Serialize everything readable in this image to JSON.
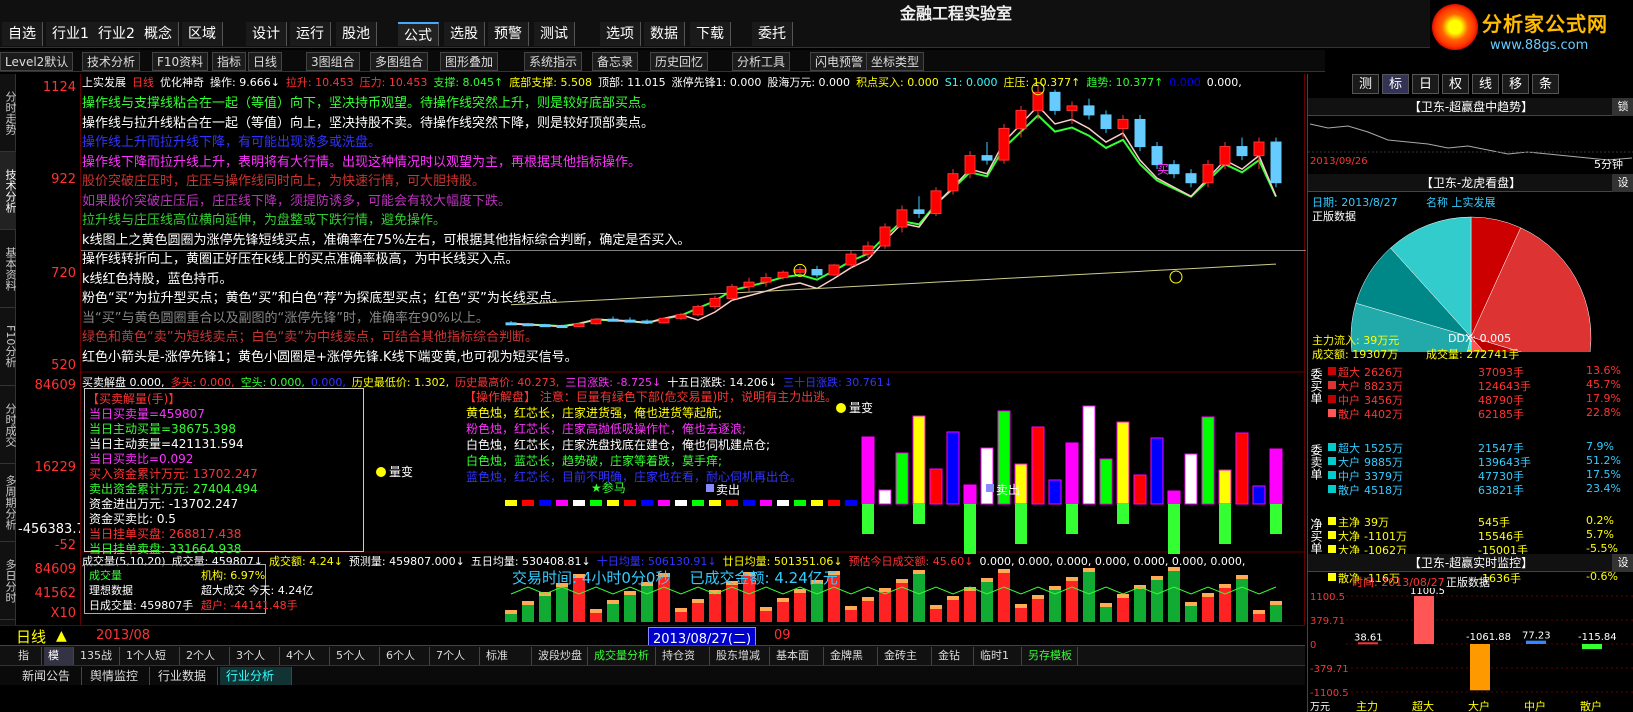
{
  "app_title": "金融工程实验室",
  "top_menu": [
    "自选",
    "行业1",
    "行业2",
    "概念",
    "区域",
    "设计",
    "运行",
    "股池",
    "公式",
    "选股",
    "预警",
    "测试",
    "选项",
    "数据",
    "下载",
    "委托"
  ],
  "toolbar": [
    "Level2默认",
    "技术分析",
    "F10资料",
    "指标",
    "日线",
    "3图组合",
    "多图组合",
    "图形叠加",
    "系统指示",
    "备忘录",
    "历史回忆",
    "分析工具",
    "闪电预警",
    "坐标类型"
  ],
  "logo": {
    "name": "分析家公式网",
    "url": "www.88gs.com"
  },
  "left_tabs": [
    "分时走势",
    "技术分析",
    "基本资料",
    "F10分析",
    "分时成交",
    "多周期分析",
    "多日分时"
  ],
  "price_scale": [
    "1124",
    "922",
    "720",
    "520"
  ],
  "vol_scale": [
    "84609",
    "16229",
    "-456383.7",
    "-52"
  ],
  "vol2_scale": [
    "84609",
    "41562",
    "X10"
  ],
  "header": {
    "name": "上实发展",
    "period": "日线",
    "indicator": "优化神奇",
    "items": [
      {
        "t": "操作: 9.666↓",
        "c": "#fff"
      },
      {
        "t": "拉升: 10.453",
        "c": "#f33"
      },
      {
        "t": "压力: 10.453",
        "c": "#f33"
      },
      {
        "t": "支撑: 8.045↑",
        "c": "#3f3"
      },
      {
        "t": "底部支撑: 5.508",
        "c": "#ff0"
      },
      {
        "t": "顶部: 11.015",
        "c": "#fff"
      },
      {
        "t": "涨停先锋1: 0.000",
        "c": "#fff"
      },
      {
        "t": "股海万元: 0.000",
        "c": "#fff"
      },
      {
        "t": "积点买入: 0.000",
        "c": "#ff0"
      },
      {
        "t": "S1: 0.000",
        "c": "#3ff"
      },
      {
        "t": "庄压: 10.377↑",
        "c": "#ff0"
      },
      {
        "t": "趋势: 10.377↑",
        "c": "#3f3"
      },
      {
        "t": "0.000",
        "c": "#00f"
      },
      {
        "t": "0.000,",
        "c": "#fff"
      }
    ]
  },
  "annotations": [
    {
      "t": "操作线与支撑线粘合在一起（等值）向下，坚决持币观望。待操作线突然上升，则是较好底部买点。",
      "c": "#3f3"
    },
    {
      "t": "操作线与拉升线粘合在一起（等值）向上，坚决持股不卖。待操作线突然下降，则是较好顶部卖点。",
      "c": "#fff"
    },
    {
      "t": "操作线上升而拉升线下降，有可能出现诱多或洗盘。",
      "c": "#33f"
    },
    {
      "t": "操作线下降而拉升线上升，表明将有大行情。出现这种情况时以观望为主，再根据其他指标操作。",
      "c": "#f3f"
    },
    {
      "t": "股价突破庄压时，庄压与操作线同时向上，为快速行情，可大胆持股。",
      "c": "#c33"
    },
    {
      "t": "如果股价突破庄压后，庄压线下降，须提防诱多，可能会有较大幅度下跌。",
      "c": "#b3b"
    },
    {
      "t": "拉升线与庄压线高位横向延伸，为盘整或下跌行情，避免操作。",
      "c": "#3c3"
    },
    {
      "t": "k线图上之黄色圆圈为涨停先锋短线买点，准确率在75%左右，可根据其他指标综合判断，确定是否买入。",
      "c": "#fff"
    },
    {
      "t": "操作线转折向上，黄圈正好压在k线上的买点准确率极高，为中长线买入点。",
      "c": "#fff"
    },
    {
      "t": "k线红色持股，蓝色持币。",
      "c": "#fff"
    },
    {
      "t": "粉色“买”为拉升型买点；黄色“买”和白色“荐”为探底型买点；红色“买”为长线买点。",
      "c": "#fff"
    },
    {
      "t": "当“买”与黄色圆圈重合以及副图的“涨停先锋”时，准确率在90%以上。",
      "c": "#888"
    },
    {
      "t": "绿色和黄色“卖”为短线卖点；白色“卖”为中线卖点，可结合其他指标综合判断。",
      "c": "#c33"
    },
    {
      "t": "红色小箭头是-涨停先锋1；黄色小圆圈是+涨停先锋.K线下端变黄,也可视为短买信号。",
      "c": "#fff"
    }
  ],
  "sub_header": [
    {
      "t": "买卖解盘 0.000,",
      "c": "#fff"
    },
    {
      "t": "多头: 0.000,",
      "c": "#f33"
    },
    {
      "t": "空头: 0.000,",
      "c": "#3f3"
    },
    {
      "t": "0.000,",
      "c": "#33f"
    },
    {
      "t": "历史最低价: 1.302,",
      "c": "#ff0"
    },
    {
      "t": "历史最高价: 40.273,",
      "c": "#f33"
    },
    {
      "t": "三日涨跌: -8.725↓",
      "c": "#f3f"
    },
    {
      "t": "十五日涨跌: 14.206↓",
      "c": "#fff"
    },
    {
      "t": "三十日涨跌: 30.761↓",
      "c": "#33f"
    }
  ],
  "vol_box": {
    "title": "【买卖解量(手)】",
    "lines": [
      {
        "t": "当日买卖量=459807",
        "c": "#f3f"
      },
      {
        "t": "当日主动买量=38675.398",
        "c": "#3f3"
      },
      {
        "t": "当日主动卖量=421131.594",
        "c": "#fff"
      },
      {
        "t": "当日买卖比=0.092",
        "c": "#f3f"
      },
      {
        "t": "买入资金累计万元: 13702.247",
        "c": "#f33"
      },
      {
        "t": "卖出资金累计万元: 27404.494",
        "c": "#3f3"
      },
      {
        "t": "资金进出万元: -13702.247",
        "c": "#fff"
      },
      {
        "t": "资金买卖比: 0.5",
        "c": "#fff"
      },
      {
        "t": "当日挂单买盘: 268817.438",
        "c": "#f33"
      },
      {
        "t": "当日挂单卖盘: 331664.938",
        "c": "#3f3"
      }
    ]
  },
  "op_box": {
    "title": "【操作解盘】 注意：巨量有绿色下部(危交易量)时，说明有主力出逃。",
    "lines": [
      {
        "t": "黄色烛，红芯长，庄家进货强，俺也进货等起航;",
        "c": "#ff0"
      },
      {
        "t": "粉色烛，红芯长，庄家高抛低吸操作忙，俺也去逐浪;",
        "c": "#f3f"
      },
      {
        "t": "白色烛，红芯长，庄家洗盘找底在建仓，俺也伺机建点仓;",
        "c": "#fff"
      },
      {
        "t": "白色烛，蓝芯长，趋势破，庄家等着跌，莫手痒;",
        "c": "#3f3"
      },
      {
        "t": "蓝色烛，红芯长，目前不明确，庄家也在看，耐心伺机再出仓。",
        "c": "#33f"
      }
    ]
  },
  "marks": {
    "liangbian": "量变",
    "maichu": "卖出",
    "canma": "参马",
    "mai": "买"
  },
  "vol_header": [
    {
      "t": "成交量(5,10,20)",
      "c": "#fff"
    },
    {
      "t": "成交量: 459807↓",
      "c": "#fff"
    },
    {
      "t": "成交额: 4.24↓",
      "c": "#ff0"
    },
    {
      "t": "预测量: 459807.000↓",
      "c": "#fff"
    },
    {
      "t": "五日均量: 530408.81↓",
      "c": "#fff"
    },
    {
      "t": "十日均量: 506130.91↓",
      "c": "#33f"
    },
    {
      "t": "廿日均量: 501351.06↓",
      "c": "#ff0"
    },
    {
      "t": "预估今日成交额: 45.60↓",
      "c": "#f33"
    },
    {
      "t": "0.000, 0.000, 0.000, 0.000, 0.000, 0.000, 0.000,",
      "c": "#fff"
    }
  ],
  "trade_info": {
    "time": "交易时间: 4小时0分0秒",
    "amount": "已成交金额: 4.24亿元"
  },
  "vol_box2": [
    "成交量",
    "理想数据",
    "日成交量: 459807手",
    "机构: 6.97%",
    "超大成交 今天: 4.24亿",
    "超户: -44141.48手"
  ],
  "status": {
    "period": "日线",
    "date_left": "2013/08",
    "date_sel": "2013/08/27(二)",
    "date_right": "09"
  },
  "bottom_tabs": [
    "指标",
    "模板",
    "135战法",
    "1个人短线",
    "2个人",
    "3个人",
    "4个人",
    "5个人",
    "6个人",
    "7个人",
    "标准",
    "波段炒盘",
    "成交量分析",
    "持仓资金",
    "股东增减",
    "基本面",
    "金牌黑马",
    "金砖主副",
    "金钻",
    "临时1",
    "另存模板"
  ],
  "bottom_tabs2": [
    "新闻公告",
    "舆情监控",
    "行业数据",
    "行业分析"
  ],
  "right_tabs": [
    "测",
    "标",
    "日",
    "权",
    "线",
    "移",
    "条"
  ],
  "panel1": {
    "title": "【卫东-超赢盘中趋势】",
    "btn": "锁",
    "date": "2013/09/26",
    "min": "5分钟"
  },
  "panel2": {
    "title": "【卫东-龙虎看盘】",
    "btn": "设",
    "date": "日期: 2013/8/27",
    "name": "名称 上实发展",
    "sub": "正版数据",
    "main_inflow": "主力流入: 39万元",
    "ddx": "DDX: 0.005",
    "turnover": "成交额: 19307万",
    "volume": "成交量: 272741手"
  },
  "pie": [
    {
      "v": 13.6,
      "c": "#c00"
    },
    {
      "v": 45.7,
      "c": "#d33"
    },
    {
      "v": 17.9,
      "c": "#b00"
    },
    {
      "v": 22.8,
      "c": "#f55"
    },
    {
      "v": 7.9,
      "c": "#0ff"
    },
    {
      "v": 51.2,
      "c": "#2aa"
    },
    {
      "v": 17.5,
      "c": "#088"
    },
    {
      "v": 23.4,
      "c": "#3cc"
    }
  ],
  "buy_rows": [
    {
      "k": "超大",
      "a": "2626万",
      "b": "37093手",
      "p": "13.6%"
    },
    {
      "k": "大户",
      "a": "8823万",
      "b": "124643手",
      "p": "45.7%"
    },
    {
      "k": "中户",
      "a": "3456万",
      "b": "48790手",
      "p": "17.9%"
    },
    {
      "k": "散户",
      "a": "4402万",
      "b": "62185手",
      "p": "22.8%"
    }
  ],
  "sell_rows": [
    {
      "k": "超大",
      "a": "1525万",
      "b": "21547手",
      "p": "7.9%"
    },
    {
      "k": "大户",
      "a": "9885万",
      "b": "139643手",
      "p": "51.2%"
    },
    {
      "k": "中户",
      "a": "3379万",
      "b": "47730手",
      "p": "17.5%"
    },
    {
      "k": "散户",
      "a": "4518万",
      "b": "63821手",
      "p": "23.4%"
    }
  ],
  "net_rows": [
    {
      "k": "主净",
      "a": "39万",
      "b": "545手",
      "p": "0.2%"
    },
    {
      "k": "大净",
      "a": "-1101万",
      "b": "15546手",
      "p": "5.7%"
    },
    {
      "k": "大净",
      "a": "-1062万",
      "b": "-15001手",
      "p": "-5.5%"
    },
    {
      "k": "中净",
      "a": "77万",
      "b": "1091手",
      "p": "0.4%"
    },
    {
      "k": "散净",
      "a": "-116万",
      "b": "-1636手",
      "p": "-0.6%"
    }
  ],
  "side_labels": {
    "buy": "委买单",
    "sell": "委卖单",
    "net": "净买单"
  },
  "panel3": {
    "title": "【卫东-超赢实时监控】",
    "btn": "设",
    "time": "时间: 2013/08/27",
    "sub": "正版数据",
    "y": [
      "1100.5",
      "379.71",
      "0",
      "-379.71",
      "-1100.5"
    ],
    "unit": "万元",
    "bars": [
      {
        "l": "主力",
        "v": 38.61
      },
      {
        "l": "超大",
        "v": 1100.5
      },
      {
        "l": "大户",
        "v": -1061.88
      },
      {
        "l": "中户",
        "v": 77.23
      },
      {
        "l": "散户",
        "v": -115.84
      }
    ]
  },
  "candles": [
    [
      600,
      604,
      596,
      598
    ],
    [
      598,
      600,
      594,
      596
    ],
    [
      596,
      598,
      592,
      594
    ],
    [
      594,
      596,
      590,
      592
    ],
    [
      592,
      600,
      590,
      598
    ],
    [
      598,
      610,
      596,
      608
    ],
    [
      608,
      614,
      604,
      606
    ],
    [
      606,
      612,
      602,
      604
    ],
    [
      604,
      608,
      598,
      600
    ],
    [
      600,
      612,
      598,
      610
    ],
    [
      610,
      622,
      606,
      618
    ],
    [
      618,
      640,
      614,
      636
    ],
    [
      636,
      660,
      630,
      654
    ],
    [
      654,
      686,
      650,
      680
    ],
    [
      680,
      700,
      670,
      690
    ],
    [
      690,
      710,
      680,
      700
    ],
    [
      700,
      716,
      696,
      712
    ],
    [
      712,
      724,
      706,
      718
    ],
    [
      718,
      726,
      700,
      706
    ],
    [
      706,
      730,
      704,
      728
    ],
    [
      728,
      760,
      722,
      752
    ],
    [
      752,
      780,
      744,
      770
    ],
    [
      770,
      820,
      764,
      812
    ],
    [
      812,
      860,
      800,
      850
    ],
    [
      850,
      880,
      832,
      842
    ],
    [
      842,
      900,
      836,
      892
    ],
    [
      892,
      940,
      884,
      930
    ],
    [
      930,
      980,
      920,
      970
    ],
    [
      970,
      1000,
      950,
      960
    ],
    [
      960,
      1040,
      952,
      1030
    ],
    [
      1030,
      1080,
      1010,
      1070
    ],
    [
      1070,
      1124,
      1050,
      1110
    ],
    [
      1110,
      1116,
      1060,
      1070
    ],
    [
      1070,
      1090,
      1040,
      1080
    ],
    [
      1080,
      1096,
      1050,
      1060
    ],
    [
      1060,
      1070,
      1020,
      1030
    ],
    [
      1030,
      1060,
      1010,
      1050
    ],
    [
      1050,
      1060,
      980,
      990
    ],
    [
      990,
      1000,
      940,
      950
    ],
    [
      950,
      960,
      920,
      930
    ],
    [
      930,
      940,
      900,
      910
    ],
    [
      910,
      960,
      900,
      950
    ],
    [
      950,
      1000,
      940,
      990
    ],
    [
      990,
      1010,
      960,
      970
    ],
    [
      970,
      1010,
      940,
      1000
    ],
    [
      1000,
      1010,
      900,
      910
    ]
  ]
}
